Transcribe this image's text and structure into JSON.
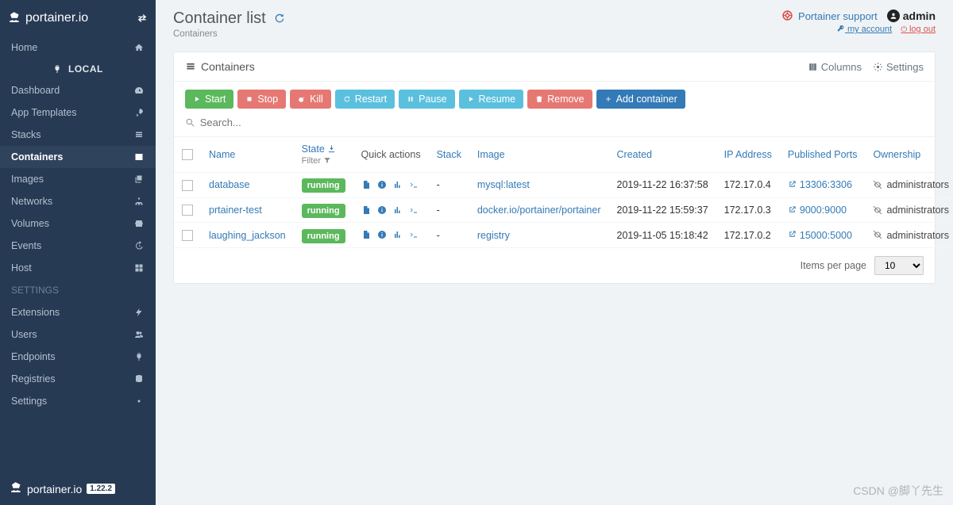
{
  "brand": "portainer.io",
  "version": "1.22.2",
  "sidebar": {
    "toggle_icon": "exchange",
    "items": [
      {
        "label": "Home",
        "icon": "home"
      },
      {
        "sep": true,
        "label": "LOCAL",
        "icon": "plug"
      },
      {
        "label": "Dashboard",
        "icon": "tach"
      },
      {
        "label": "App Templates",
        "icon": "rocket"
      },
      {
        "label": "Stacks",
        "icon": "list"
      },
      {
        "label": "Containers",
        "icon": "inbox",
        "active": true
      },
      {
        "label": "Images",
        "icon": "clone"
      },
      {
        "label": "Networks",
        "icon": "sitemap"
      },
      {
        "label": "Volumes",
        "icon": "hdd"
      },
      {
        "label": "Events",
        "icon": "history"
      },
      {
        "label": "Host",
        "icon": "th"
      },
      {
        "heading": true,
        "label": "SETTINGS"
      },
      {
        "label": "Extensions",
        "icon": "bolt"
      },
      {
        "label": "Users",
        "icon": "users"
      },
      {
        "label": "Endpoints",
        "icon": "plug"
      },
      {
        "label": "Registries",
        "icon": "database"
      },
      {
        "label": "Settings",
        "icon": "cogs"
      }
    ]
  },
  "header": {
    "title": "Container list",
    "breadcrumb": "Containers",
    "support": "Portainer support",
    "user": "admin",
    "my_account": "my account",
    "log_out": "log out"
  },
  "panel": {
    "title": "Containers",
    "columns_btn": "Columns",
    "settings_btn": "Settings"
  },
  "toolbar": {
    "start": "Start",
    "stop": "Stop",
    "kill": "Kill",
    "restart": "Restart",
    "pause": "Pause",
    "resume": "Resume",
    "remove": "Remove",
    "add": "Add container"
  },
  "search": {
    "placeholder": "Search..."
  },
  "table": {
    "headers": {
      "name": "Name",
      "state": "State",
      "filter": "Filter",
      "quick_actions": "Quick actions",
      "stack": "Stack",
      "image": "Image",
      "created": "Created",
      "ip": "IP Address",
      "ports": "Published Ports",
      "ownership": "Ownership"
    },
    "rows": [
      {
        "name": "database",
        "state": "running",
        "stack": "-",
        "image": "mysql:latest",
        "created": "2019-11-22 16:37:58",
        "ip": "172.17.0.4",
        "ports": "13306:3306",
        "owner": "administrators"
      },
      {
        "name": "prtainer-test",
        "state": "running",
        "stack": "-",
        "image": "docker.io/portainer/portainer",
        "created": "2019-11-22 15:59:37",
        "ip": "172.17.0.3",
        "ports": "9000:9000",
        "owner": "administrators"
      },
      {
        "name": "laughing_jackson",
        "state": "running",
        "stack": "-",
        "image": "registry",
        "created": "2019-11-05 15:18:42",
        "ip": "172.17.0.2",
        "ports": "15000:5000",
        "owner": "administrators"
      }
    ]
  },
  "pager": {
    "label": "Items per page",
    "value": "10"
  },
  "watermark": "CSDN @脚丫先生"
}
